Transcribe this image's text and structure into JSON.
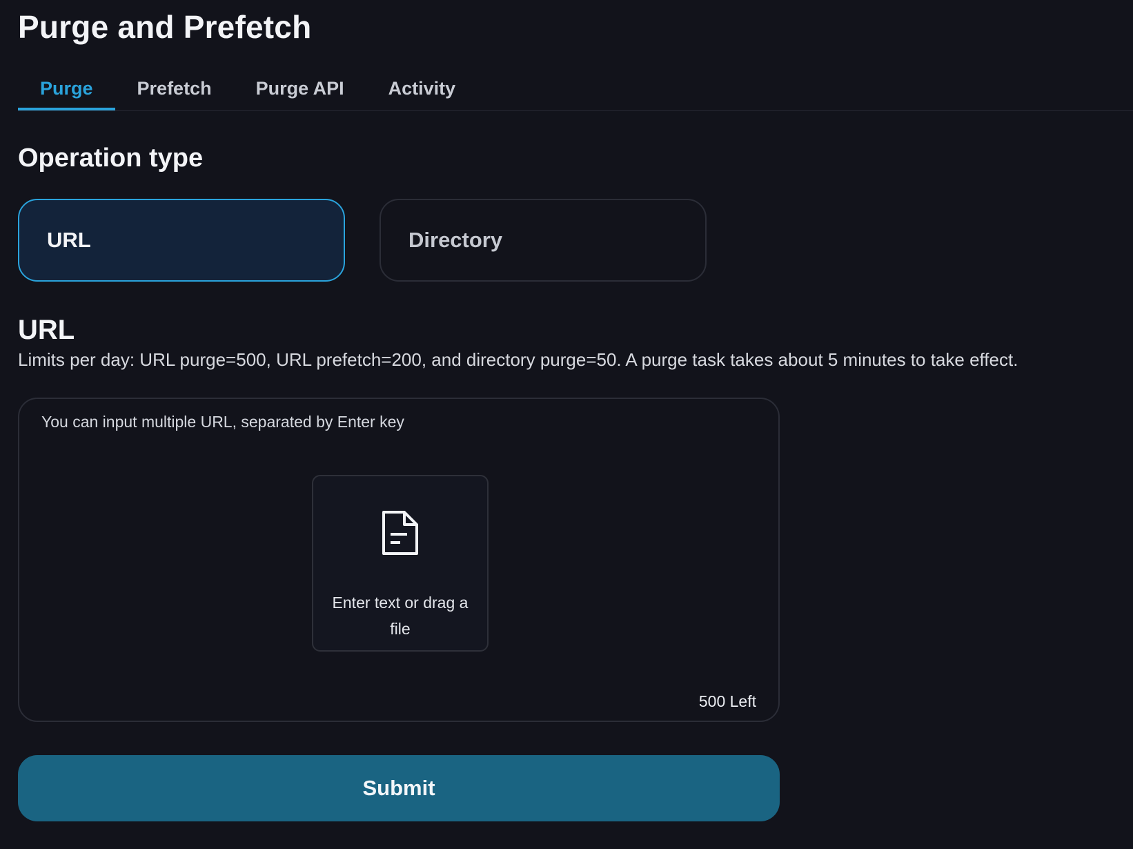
{
  "page": {
    "title": "Purge and Prefetch"
  },
  "tabs": [
    {
      "label": "Purge",
      "active": true
    },
    {
      "label": "Prefetch",
      "active": false
    },
    {
      "label": "Purge API",
      "active": false
    },
    {
      "label": "Activity",
      "active": false
    }
  ],
  "operation": {
    "title": "Operation type",
    "options": [
      {
        "label": "URL",
        "selected": true
      },
      {
        "label": "Directory",
        "selected": false
      }
    ]
  },
  "url_section": {
    "title": "URL",
    "limits_text": "Limits per day: URL purge=500, URL prefetch=200, and directory purge=50. A purge task takes about 5 minutes to take effect.",
    "input": {
      "placeholder": "You can input multiple URL, separated by Enter key",
      "value": "",
      "drop_label": "Enter text or drag a file",
      "drop_icon": "file-document-icon",
      "remaining": "500 Left"
    }
  },
  "actions": {
    "submit_label": "Submit"
  },
  "colors": {
    "background": "#12131b",
    "accent": "#2aa3dc",
    "selected_card_bg": "#13233a",
    "submit_bg": "#1a6482",
    "border": "#2b2d37"
  }
}
